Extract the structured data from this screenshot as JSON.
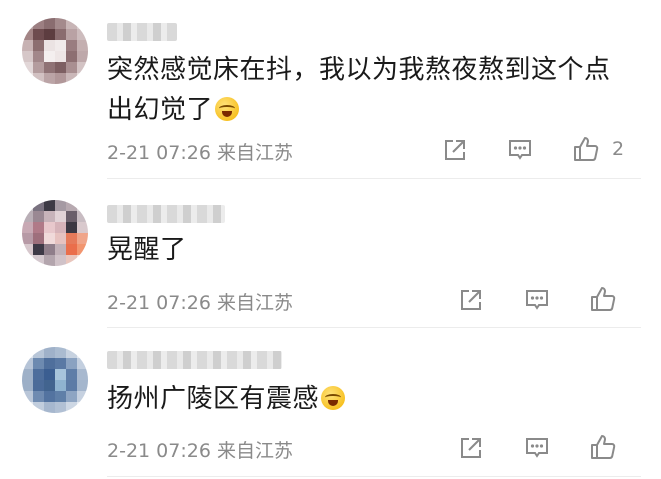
{
  "comments": [
    {
      "text_line1": "突然感觉床在抖，我以为我熬夜熬到这个点",
      "text_line2": "出幻觉了",
      "meta": "2-21 07:26 来自江苏",
      "likes": "2"
    },
    {
      "text_line1": "晃醒了",
      "meta": "2-21 07:26 来自江苏"
    },
    {
      "text_line1": "扬州广陵区有震感",
      "meta": "2-21 07:26 来自江苏"
    }
  ],
  "icons": {
    "share": "share-icon",
    "comment": "comment-icon",
    "like": "thumbs-up-icon",
    "emoji": "laugh-cry-emoji-icon"
  },
  "colors": {
    "text": "#1a1a1a",
    "meta": "#8a8a8a",
    "icon": "#8a8a8a",
    "divider": "#ececec"
  }
}
